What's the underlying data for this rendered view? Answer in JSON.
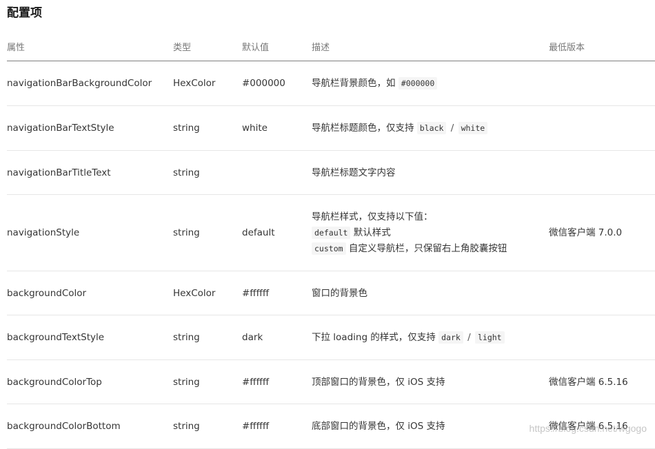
{
  "page_title": "配置项",
  "headers": {
    "property": "属性",
    "type": "类型",
    "default": "默认值",
    "description": "描述",
    "min_version": "最低版本"
  },
  "rows": [
    {
      "property": "navigationBarBackgroundColor",
      "type": "HexColor",
      "default": "#000000",
      "desc_text": "导航栏背景颜色，如",
      "desc_code": "#000000",
      "min_version": ""
    },
    {
      "property": "navigationBarTextStyle",
      "type": "string",
      "default": "white",
      "desc_text": "导航栏标题颜色，仅支持",
      "desc_code_1": "black",
      "separator": "/",
      "desc_code_2": "white",
      "min_version": ""
    },
    {
      "property": "navigationBarTitleText",
      "type": "string",
      "default": "",
      "desc_text": "导航栏标题文字内容",
      "min_version": ""
    },
    {
      "property": "navigationStyle",
      "type": "string",
      "default": "default",
      "desc_line_1": "导航栏样式，仅支持以下值：",
      "desc_line_2_code": "default",
      "desc_line_2_text": "默认样式",
      "desc_line_3_code": "custom",
      "desc_line_3_text": "自定义导航栏，只保留右上角胶囊按钮",
      "min_version": "微信客户端 7.0.0"
    },
    {
      "property": "backgroundColor",
      "type": "HexColor",
      "default": "#ffffff",
      "desc_text": "窗口的背景色",
      "min_version": ""
    },
    {
      "property": "backgroundTextStyle",
      "type": "string",
      "default": "dark",
      "desc_text": "下拉 loading 的样式，仅支持",
      "desc_code_1": "dark",
      "separator": "/",
      "desc_code_2": "light",
      "min_version": ""
    },
    {
      "property": "backgroundColorTop",
      "type": "string",
      "default": "#ffffff",
      "desc_text": "顶部窗口的背景色，仅 iOS 支持",
      "min_version": "微信客户端 6.5.16"
    },
    {
      "property": "backgroundColorBottom",
      "type": "string",
      "default": "#ffffff",
      "desc_text": "底部窗口的背景色，仅 iOS 支持",
      "min_version": "微信客户端 6.5.16"
    }
  ],
  "watermark": "https://blog.csdn.net/wgogo"
}
